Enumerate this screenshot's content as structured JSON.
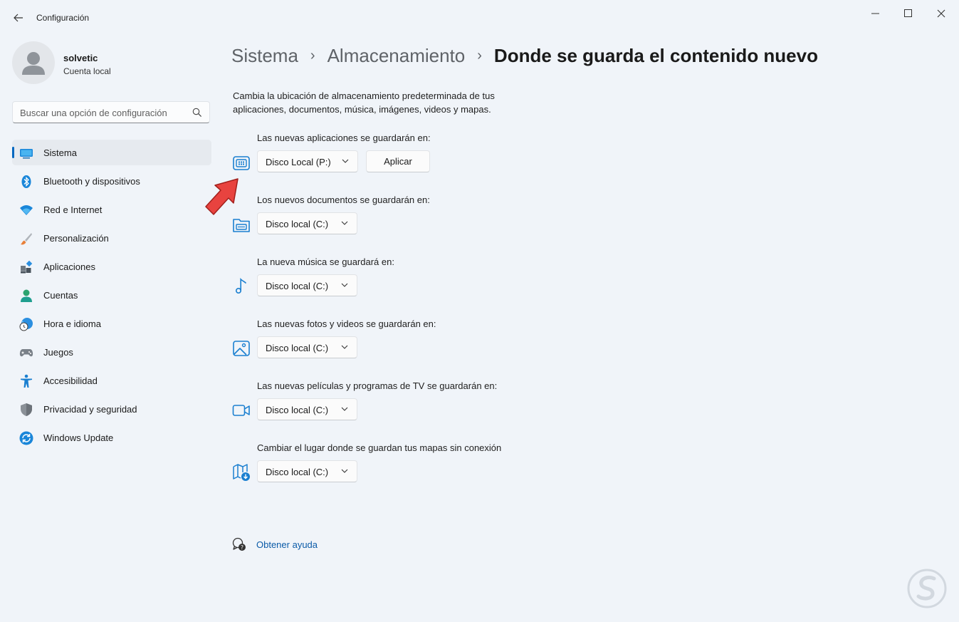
{
  "app": {
    "title": "Configuración"
  },
  "profile": {
    "name": "solvetic",
    "account_type": "Cuenta local"
  },
  "search": {
    "placeholder": "Buscar una opción de configuración"
  },
  "sidebar": {
    "items": [
      {
        "label": "Sistema",
        "icon": "system-icon"
      },
      {
        "label": "Bluetooth y dispositivos",
        "icon": "bluetooth-icon"
      },
      {
        "label": "Red e Internet",
        "icon": "wifi-icon"
      },
      {
        "label": "Personalización",
        "icon": "brush-icon"
      },
      {
        "label": "Aplicaciones",
        "icon": "apps-icon"
      },
      {
        "label": "Cuentas",
        "icon": "account-icon"
      },
      {
        "label": "Hora e idioma",
        "icon": "clock-globe-icon"
      },
      {
        "label": "Juegos",
        "icon": "gamepad-icon"
      },
      {
        "label": "Accesibilidad",
        "icon": "accessibility-icon"
      },
      {
        "label": "Privacidad y seguridad",
        "icon": "shield-icon"
      },
      {
        "label": "Windows Update",
        "icon": "update-icon"
      }
    ],
    "active_index": 0
  },
  "breadcrumb": {
    "level1": "Sistema",
    "level2": "Almacenamiento",
    "current": "Donde se guarda el contenido nuevo",
    "separator": "›"
  },
  "description": "Cambia la ubicación de almacenamiento predeterminada de tus aplicaciones, documentos, música, imágenes, videos y mapas.",
  "settings": [
    {
      "label": "Las nuevas aplicaciones se guardarán en:",
      "value": "Disco Local (P:)",
      "icon": "apps-grid-icon"
    },
    {
      "label": "Los nuevos documentos se guardarán en:",
      "value": "Disco local (C:)",
      "icon": "folder-icon"
    },
    {
      "label": "La nueva música se guardará en:",
      "value": "Disco local (C:)",
      "icon": "music-note-icon"
    },
    {
      "label": "Las nuevas fotos y videos se guardarán en:",
      "value": "Disco local (C:)",
      "icon": "picture-icon"
    },
    {
      "label": "Las nuevas películas y programas de TV se guardarán en:",
      "value": "Disco local (C:)",
      "icon": "video-camera-icon"
    },
    {
      "label": "Cambiar el lugar donde se guardan tus mapas sin conexión",
      "value": "Disco local (C:)",
      "icon": "map-download-icon"
    }
  ],
  "apply_button": {
    "label": "Aplicar"
  },
  "help": {
    "label": "Obtener ayuda"
  },
  "colors": {
    "accent": "#0067c0",
    "background": "#f0f4f9",
    "link": "#0b5ba8",
    "annotation_arrow": "#e8433f"
  }
}
